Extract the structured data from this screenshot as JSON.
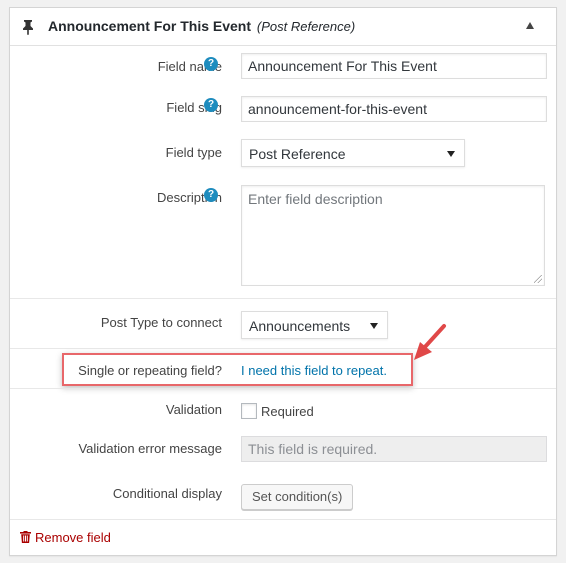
{
  "header": {
    "title": "Announcement For This Event",
    "subtitle": "(Post Reference)",
    "pin_icon": "pin-icon",
    "collapse_icon": "triangle-up-icon"
  },
  "fields": {
    "field_name": {
      "label": "Field name",
      "value": "Announcement For This Event",
      "help_icon": "?"
    },
    "field_slug": {
      "label": "Field slug",
      "value": "announcement-for-this-event",
      "help_icon": "?"
    },
    "field_type": {
      "label": "Field type",
      "selected": "Post Reference"
    },
    "description": {
      "label": "Description",
      "placeholder": "Enter field description",
      "help_icon": "?"
    },
    "post_type": {
      "label": "Post Type to connect",
      "selected": "Announcements"
    },
    "repeating": {
      "label": "Single or repeating field?",
      "link": "I need this field to repeat."
    },
    "validation": {
      "label": "Validation",
      "checkbox_label": "Required",
      "checked": false
    },
    "validation_error": {
      "label": "Validation error message",
      "placeholder": "This field is required."
    },
    "conditional": {
      "label": "Conditional display",
      "button": "Set condition(s)"
    }
  },
  "footer": {
    "remove_label": "Remove field"
  },
  "colors": {
    "link": "#0073aa",
    "help": "#1e8cbe",
    "remove": "#aa0000",
    "highlight": "#e8676a"
  }
}
